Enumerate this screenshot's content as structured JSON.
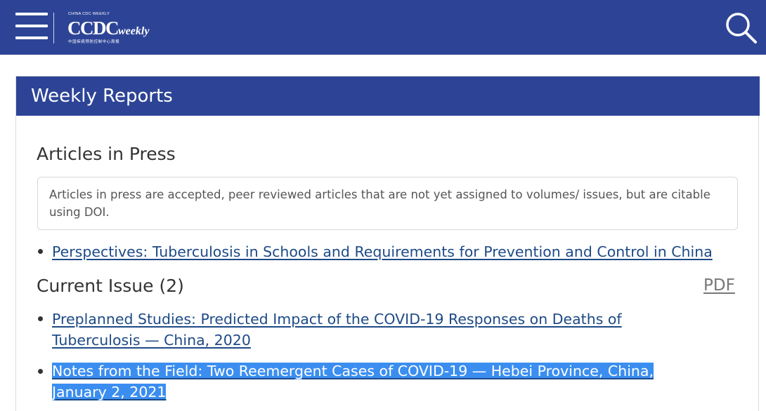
{
  "header": {
    "menu_icon": "hamburger-menu-icon",
    "logo": {
      "top_text": "CHINA CDC WEEKLY",
      "main_text": "CCDC",
      "main_suffix": "weekly",
      "bottom_text": "中国疾病预防控制中心周报"
    },
    "search_icon": "search-icon",
    "colors": {
      "bar": "#2d4496"
    }
  },
  "panel": {
    "title": "Weekly Reports",
    "articles_in_press": {
      "title": "Articles in Press",
      "notice": "Articles in press are accepted, peer reviewed articles that are not yet assigned to volumes/ issues, but are citable using DOI.",
      "items": [
        "Perspectives: Tuberculosis in Schools and Requirements for Prevention and Control in China"
      ]
    },
    "current_issue": {
      "title": "Current Issue (2)",
      "pdf_label": "PDF",
      "items": [
        "Preplanned Studies: Predicted Impact of the COVID-19 Responses on Deaths of Tuberculosis — China, 2020",
        "Notes from the Field: Two Reemergent Cases of COVID-19 — Hebei Province, China, January 2, 2021"
      ]
    }
  },
  "colors": {
    "link": "#1d4a86",
    "selection": "#3b8ef0"
  }
}
